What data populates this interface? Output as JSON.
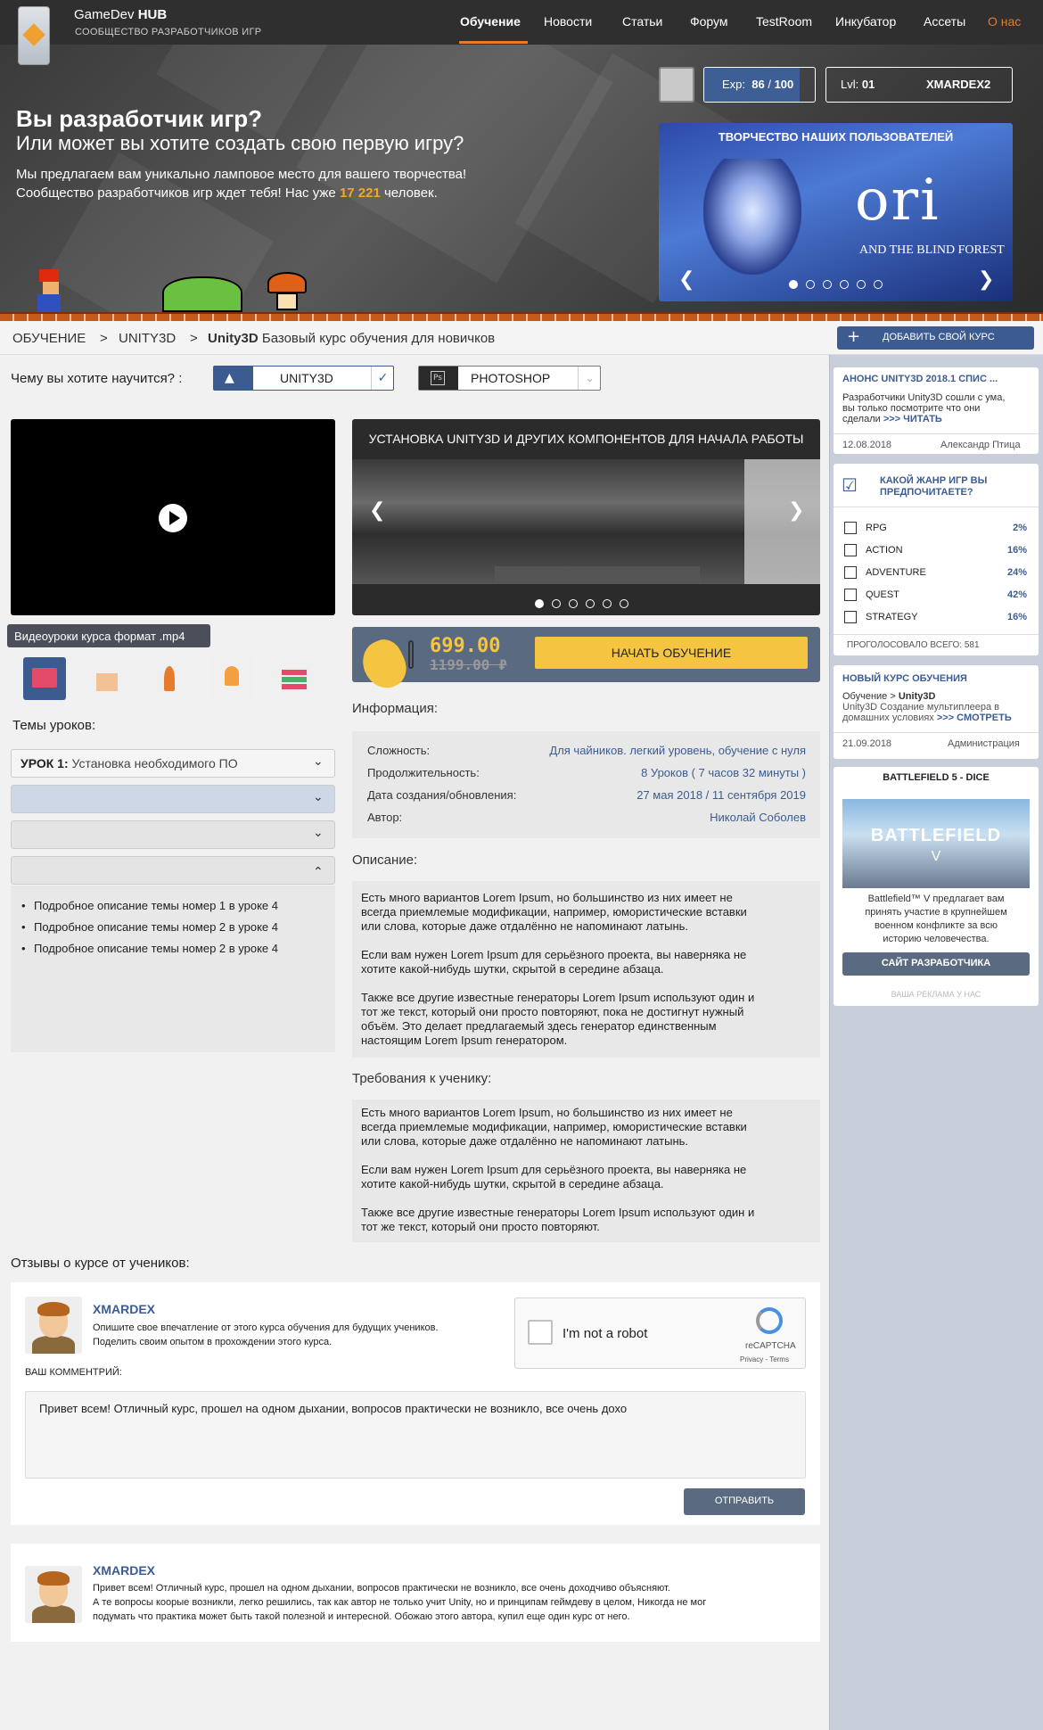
{
  "brand": {
    "name_light": "GameDev ",
    "name_bold": "HUB",
    "tagline": "СООБЩЕСТВО РАЗРАБОТЧИКОВ ИГР"
  },
  "nav": [
    "Обучение",
    "Новости",
    "Статьи",
    "Форум",
    "TestRoom",
    "Инкубатор",
    "Ассеты",
    "О нас"
  ],
  "nav_active_color": "#e87a2c",
  "hero": {
    "title": "Вы разработчик игр?",
    "subtitle": "Или может вы хотите создать свою первую игру?",
    "line1": "Мы предлагаем вам уникально ламповое место для вашего творчества!",
    "line2_pre": "Сообщество разработчиков игр ждет тебя! Нас уже ",
    "line2_num": "17 221",
    "line2_post": " человек."
  },
  "user": {
    "exp_label": "Exp:",
    "exp_value": "86",
    "exp_max": "100",
    "exp_fraction": 0.86,
    "lvl_label": "Lvl:",
    "lvl_value": "01",
    "username": "XMARDEX2"
  },
  "slider": {
    "title": "ТВОРЧЕСТВО НАШИХ ПОЛЬЗОВАТЕЛЕЙ",
    "game_title": "ori",
    "game_sub": "AND THE BLIND FOREST",
    "dots": 6,
    "active_dot": 0
  },
  "breadcrumb": {
    "items": [
      "ОБУЧЕНИЕ",
      ">",
      "UNITY3D",
      ">"
    ],
    "current_bold": "Unity3D",
    "current_rest": " Базовый курс обучения для новичков"
  },
  "add_course": "ДОБАВИТЬ СВОЙ КУРС",
  "learn": {
    "label": "Чему вы хотите научится? :",
    "sel1": "UNITY3D",
    "sel2": "PHOTOSHOP"
  },
  "video": {
    "tooltip": "Видеоуроки курса формат .mp4"
  },
  "topics": {
    "label": "Темы уроков:",
    "first_bold": "УРОК 1:",
    "first_rest": " Установка необходимого ПО",
    "bullets": [
      "Подробное описание темы номер 1 в уроке 4",
      "Подробное описание темы номер 2 в уроке 4",
      "Подробное описание темы номер 2 в уроке 4"
    ]
  },
  "course_slider": {
    "title": "УСТАНОВКА UNITY3D И ДРУГИХ КОМПОНЕНТОВ ДЛЯ НАЧАЛА РАБОТЫ",
    "dots": 6,
    "active_dot": 0
  },
  "price": {
    "current": "699.00",
    "old": "1199.00 ₽",
    "cta": "НАЧАТЬ ОБУЧЕНИЕ"
  },
  "info": {
    "label": "Информация:",
    "rows": [
      {
        "k": "Сложность:",
        "v": "Для чайников. легкий уровень, обучение с нуля"
      },
      {
        "k": "Продолжительность:",
        "v": "8 Уроков ( 7 часов 32 минуты )"
      },
      {
        "k": "Дата создания/обновления:",
        "v": "27 мая 2018 / 11 сентября 2019"
      },
      {
        "k": "Автор:",
        "v": "Николай Соболев"
      }
    ]
  },
  "description": {
    "label": "Описание:",
    "p1": [
      "Есть много вариантов Lorem Ipsum, но большинство из них имеет не",
      "всегда приемлемые модификации, например, юмористические вставки",
      "или слова, которые даже отдалённо не напоминают латынь."
    ],
    "p2": [
      "Если вам нужен Lorem Ipsum для серьёзного проекта, вы наверняка не",
      "хотите какой-нибудь шутки, скрытой в середине абзаца."
    ],
    "p3": [
      "Также все другие известные генераторы Lorem Ipsum используют один и",
      "тот же текст, который они просто повторяют, пока не достигнут нужный",
      "объём. Это делает предлагаемый здесь генератор единственным",
      "настоящим Lorem Ipsum генератором."
    ]
  },
  "requirements": {
    "label": "Требования к ученику:",
    "p1": [
      "Есть много вариантов Lorem Ipsum, но большинство из них имеет не",
      "всегда приемлемые модификации, например, юмористические вставки",
      "или слова, которые даже отдалённо не напоминают латынь."
    ],
    "p2": [
      "Если вам нужен Lorem Ipsum для серьёзного проекта, вы наверняка не",
      "хотите какой-нибудь шутки, скрытой в середине абзаца."
    ],
    "p3": [
      "Также все другие известные генераторы Lorem Ipsum используют один и",
      "тот же текст, который они просто повторяют."
    ]
  },
  "reviews": {
    "label": "Отзывы о курсе от учеников:",
    "form": {
      "name": "XMARDEX",
      "hint1": "Опишите свое впечатление от этого курса обучения для будущих учеников.",
      "hint2": "Поделить своим опытом в прохождении этого курса.",
      "comment_label": "ВАШ КОММЕНТРИЙ:",
      "comment_value": "Привет всем! Отличный курс, прошел на одном дыхании, вопросов практически не возникло, все очень дохо",
      "send": "ОТПРАВИТЬ",
      "captcha": "I'm not a robot",
      "captcha_brand": "reCAPTCHA",
      "captcha_links": "Privacy - Terms"
    },
    "items": [
      {
        "name": "XMARDEX",
        "lines": [
          "Привет всем! Отличный курс, прошел на одном дыхании, вопросов практически не возникло, все очень доходчиво объясняют.",
          "А те вопросы коорые возникли, легко решились, так как автор не только учит Unity, но и принципам геймдеву в целом, Никогда не мог",
          "подумать что практика может быть такой полезной и интересной. Обожаю этого автора, купил еще один курс от него."
        ]
      }
    ]
  },
  "sidebar": {
    "news": {
      "title": "АНОНС UNITY3D 2018.1 СПИС ...",
      "text1": "Разработчики Unity3D сошли с ума,",
      "text2": "вы только посмотрите что они",
      "text3_pre": "сделали ",
      "text3_link": ">>> ЧИТАТЬ",
      "date": "12.08.2018",
      "author": "Александр Птица"
    },
    "poll": {
      "title1": "КАКОЙ ЖАНР ИГР ВЫ",
      "title2": "ПРЕДПОЧИТАЕТЕ?",
      "options": [
        {
          "label": "RPG",
          "pct": "2%"
        },
        {
          "label": "ACTION",
          "pct": "16%"
        },
        {
          "label": "ADVENTURE",
          "pct": "24%"
        },
        {
          "label": "QUEST",
          "pct": "42%"
        },
        {
          "label": "STRATEGY",
          "pct": "16%"
        }
      ],
      "total": "ПРОГОЛОСОВАЛО ВСЕГО: 581"
    },
    "course": {
      "title": "НОВЫЙ КУРС ОБУЧЕНИЯ",
      "crumb_pre": "Обучение > ",
      "crumb_bold": "Unity3D",
      "text1": "Unity3D Создание мультиплеера в",
      "text2_pre": "домашних условиях ",
      "text2_link": ">>> СМОТРЕТЬ",
      "date": "21.09.2018",
      "author": "Администрация"
    },
    "ad": {
      "title": "BATTLEFIELD 5 - DICE",
      "img_text": "BATTLEFIELD",
      "img_sub": "V",
      "text": [
        "Battlefield™ V предлагает вам",
        "принять участие в крупнейшем",
        "военном конфликте за всю",
        "историю человечества."
      ],
      "button": "САЙТ РАЗРАБОТЧИКА",
      "footer": "ВАША РЕКЛАМА У НАС"
    }
  }
}
